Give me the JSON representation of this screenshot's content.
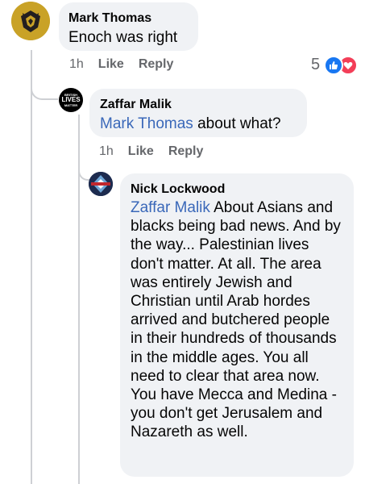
{
  "comments": [
    {
      "author": "Mark Thomas",
      "text": "Enoch was right",
      "time": "1h",
      "like": "Like",
      "reply": "Reply",
      "reaction_count": "5"
    },
    {
      "author": "Zaffar Malik",
      "mention": "Mark Thomas",
      "text": " about what?",
      "time": "1h",
      "like": "Like",
      "reply": "Reply",
      "avatar_text": [
        "BRITISH",
        "LIVES",
        "MATTER"
      ]
    },
    {
      "author": "Nick Lockwood",
      "mention": "Zaffar Malik",
      "text": " About Asians and blacks being bad news. And by the way... Palestinian lives don't matter. At all. The area was entirely Jewish and Christian until Arab hordes arrived and butchered people in their hundreds of thousands in the middle ages. You all need to clear that area now. You have Mecca and Medina - you don't get Jerusalem and Nazareth as well."
    }
  ],
  "colors": {
    "bubble": "#f0f2f5",
    "link": "#3a68b9",
    "meta": "#65676b",
    "like_blue": "#1877f2",
    "love_red": "#f33e58",
    "wolves_gold": "#c9a227"
  },
  "icons": {
    "like": "thumbs-up-icon",
    "love": "heart-icon",
    "club": "wolf-crest-icon"
  }
}
